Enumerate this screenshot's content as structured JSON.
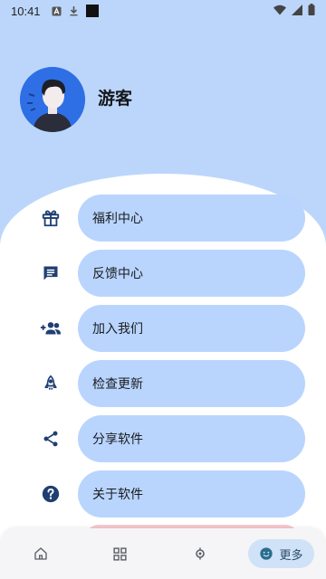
{
  "status_bar": {
    "time": "10:41"
  },
  "profile": {
    "name": "游客"
  },
  "menu": {
    "items": [
      {
        "label": "福利中心",
        "icon": "gift-icon"
      },
      {
        "label": "反馈中心",
        "icon": "feedback-icon"
      },
      {
        "label": "加入我们",
        "icon": "add-group-icon"
      },
      {
        "label": "检查更新",
        "icon": "rocket-icon"
      },
      {
        "label": "分享软件",
        "icon": "share-icon"
      },
      {
        "label": "关于软件",
        "icon": "help-icon"
      }
    ]
  },
  "bottom_nav": {
    "items": [
      {
        "name": "home",
        "icon": "home-icon"
      },
      {
        "name": "apps",
        "icon": "grid-icon"
      },
      {
        "name": "explore",
        "icon": "compass-icon"
      },
      {
        "name": "more",
        "icon": "smile-icon",
        "label": "更多",
        "active": true
      }
    ]
  },
  "colors": {
    "background": "#bcd6fb",
    "pill": "#b9d5fd",
    "icon": "#1f3f73",
    "nav_active": "#cfe2f8"
  }
}
